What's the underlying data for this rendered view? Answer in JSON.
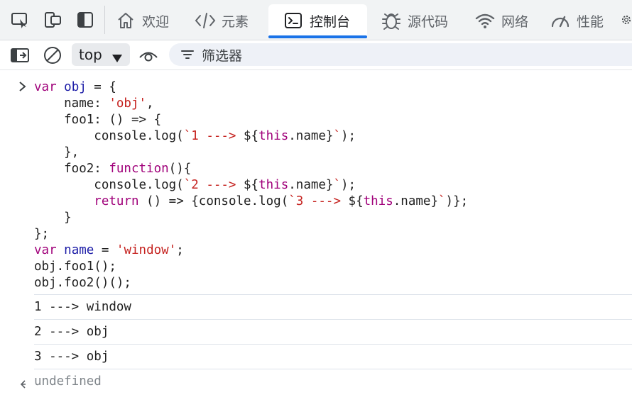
{
  "tabs": [
    {
      "label": "欢迎",
      "icon": "home-icon"
    },
    {
      "label": "元素",
      "icon": "code-icon"
    },
    {
      "label": "控制台",
      "icon": "console-icon",
      "active": true
    },
    {
      "label": "源代码",
      "icon": "bug-icon"
    },
    {
      "label": "网络",
      "icon": "wifi-icon"
    },
    {
      "label": "性能",
      "icon": "gauge-icon"
    }
  ],
  "toolbar": {
    "context_value": "top",
    "filter_placeholder": "筛选器"
  },
  "console": {
    "input_code": [
      [
        {
          "t": "var",
          "c": "kw"
        },
        {
          "t": " "
        },
        {
          "t": "obj",
          "c": "var"
        },
        {
          "t": " = {"
        }
      ],
      [
        {
          "t": "    name: "
        },
        {
          "t": "'obj'",
          "c": "str"
        },
        {
          "t": ","
        }
      ],
      [
        {
          "t": "    foo1: () => {"
        }
      ],
      [
        {
          "t": "        console.log("
        },
        {
          "t": "`1 ---> ",
          "c": "str"
        },
        {
          "t": "${"
        },
        {
          "t": "this",
          "c": "kw"
        },
        {
          "t": ".name}"
        },
        {
          "t": "`",
          "c": "str"
        },
        {
          "t": ");"
        }
      ],
      [
        {
          "t": "    },"
        }
      ],
      [
        {
          "t": "    foo2: "
        },
        {
          "t": "function",
          "c": "kw"
        },
        {
          "t": "(){"
        }
      ],
      [
        {
          "t": "        console.log("
        },
        {
          "t": "`2 ---> ",
          "c": "str"
        },
        {
          "t": "${"
        },
        {
          "t": "this",
          "c": "kw"
        },
        {
          "t": ".name}"
        },
        {
          "t": "`",
          "c": "str"
        },
        {
          "t": ");"
        }
      ],
      [
        {
          "t": "        "
        },
        {
          "t": "return",
          "c": "kw"
        },
        {
          "t": " () => {console.log("
        },
        {
          "t": "`3 ---> ",
          "c": "str"
        },
        {
          "t": "${"
        },
        {
          "t": "this",
          "c": "kw"
        },
        {
          "t": ".name}"
        },
        {
          "t": "`",
          "c": "str"
        },
        {
          "t": ")};"
        }
      ],
      [
        {
          "t": "    }"
        }
      ],
      [
        {
          "t": "};"
        }
      ],
      [
        {
          "t": "var",
          "c": "kw"
        },
        {
          "t": " "
        },
        {
          "t": "name",
          "c": "var"
        },
        {
          "t": " = "
        },
        {
          "t": "'window'",
          "c": "str"
        },
        {
          "t": ";"
        }
      ],
      [
        {
          "t": "obj.foo1();"
        }
      ],
      [
        {
          "t": "obj.foo2()();"
        }
      ]
    ],
    "outputs": [
      "1 ---> window",
      "2 ---> obj",
      "3 ---> obj"
    ],
    "result": "undefined"
  },
  "colors": {
    "accent": "#1a73e8",
    "keyword": "#a0007a",
    "variable": "#1a1aa6",
    "string": "#c5221f",
    "muted": "#80868b"
  }
}
